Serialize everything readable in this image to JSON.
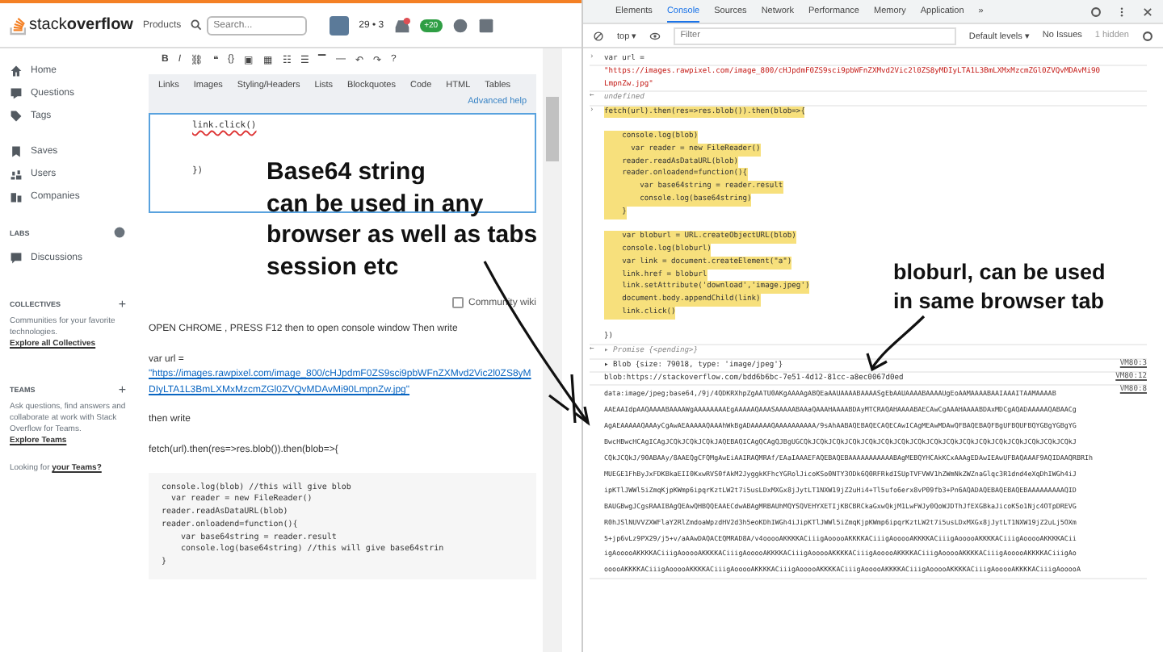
{
  "site": {
    "logo": "stack**overflow**",
    "nav": "Products",
    "search": {
      "placeholder": "Search..."
    },
    "reputation": "29 • 3",
    "achievement": "+20"
  },
  "sidebar": {
    "items": [
      {
        "label": "Home"
      },
      {
        "label": "Questions"
      },
      {
        "label": "Tags"
      }
    ],
    "items2": [
      {
        "label": "Saves"
      },
      {
        "label": "Users"
      },
      {
        "label": "Companies"
      }
    ],
    "labs": {
      "title": "LABS",
      "item": "Discussions"
    },
    "collectives": {
      "title": "COLLECTIVES",
      "add": "+",
      "text": "Communities for your favorite technologies.",
      "link": "Explore all Collectives"
    },
    "teams": {
      "title": "TEAMS",
      "add": "+",
      "text": "Ask questions, find answers and collaborate at work with Stack Overflow for Teams.",
      "link": "Explore Teams"
    },
    "looking": {
      "text": "Looking for",
      "link": "your Teams?"
    }
  },
  "editor": {
    "toolbar": [
      "B",
      "I",
      "⛓",
      "❝",
      "{}",
      "▣",
      "▦",
      "☷",
      "☰",
      "▔",
      "—",
      "↶",
      "↷",
      "?"
    ],
    "help_tabs": [
      "Links",
      "Images",
      "Styling/Headers",
      "Lists",
      "Blockquotes",
      "Code",
      "HTML",
      "Tables"
    ],
    "advanced": "Advanced help",
    "lines": [
      "link.click()",
      "})"
    ],
    "community_wiki": {
      "label": "Community wiki",
      "checked": false
    }
  },
  "answer": {
    "intro": "OPEN CHROME , PRESS F12 then to open console window Then write",
    "var": "var url =",
    "url": "\"https://images.rawpixel.com/image_800/cHJpdmF0ZS9sci9pbWFnZXMvd2Vic2l0ZS8yMDIyLTA1L3BmLXMxMzcmZGl0ZVQvMDAvMi90LmpnZw.jpg\"",
    "then": "then write",
    "fetch": "fetch(url).then(res=>res.blob()).then(blob=>{",
    "code": [
      "console.log(blob) //this will give blob",
      "  var reader = new FileReader()",
      "reader.readAsDataURL(blob)",
      "reader.onloadend=function(){",
      "    var base64string = reader.result",
      "    console.log(base64string) //this will give base64strin",
      "}"
    ]
  },
  "devtools": {
    "tabs": [
      {
        "label": "Elements",
        "selected": false
      },
      {
        "label": "Console",
        "selected": true
      },
      {
        "label": "Sources",
        "selected": false
      },
      {
        "label": "Network",
        "selected": false
      },
      {
        "label": "Performance",
        "selected": false
      },
      {
        "label": "Memory",
        "selected": false
      },
      {
        "label": "Application",
        "selected": false
      }
    ],
    "more": "»",
    "context": "top ▾",
    "filter": {
      "placeholder": "Filter"
    },
    "levels": "Default levels ▾",
    "issues": "No Issues",
    "hidden": "1 hidden",
    "console": [
      {
        "kind": "input",
        "prompt": "›",
        "lines": [
          "var url ="
        ]
      },
      {
        "kind": "string",
        "lines": [
          "\"https://images.rawpixel.com/image_800/cHJpdmF0ZS9sci9pbWFnZXMvd2Vic2l0ZS8yMDIyLTA1L3BmLXMxMzcmZGl0ZVQvMDAvMi90",
          "LmpnZw.jpg\""
        ]
      },
      {
        "kind": "result",
        "prompt": "←",
        "lines": [
          "undefined"
        ]
      },
      {
        "kind": "highlight",
        "prompt": "›",
        "blocks": [
          [
            "fetch(url).then(res=>res.blob()).then(blob=>{"
          ],
          [
            "    console.log(blob)",
            "      var reader = new FileReader()",
            "    reader.readAsDataURL(blob)",
            "    reader.onloadend=function(){",
            "        var base64string = reader.result",
            "        console.log(base64string)",
            "    }"
          ],
          [
            "    var bloburl = URL.createObjectURL(blob)",
            "    console.log(bloburl)",
            "    var link = document.createElement(\"a\")",
            "    link.href = bloburl",
            "    link.setAttribute('download','image.jpeg')",
            "    document.body.appendChild(link)",
            "    link.click()"
          ]
        ],
        "lines": [
          "})"
        ]
      },
      {
        "kind": "result",
        "prompt": "←",
        "lines": [
          "▸ Promise {<pending>}"
        ]
      },
      {
        "kind": "log",
        "lines": [
          "▸ Blob {size: 79018, type: 'image/jpeg'}"
        ],
        "source": "VM80:3"
      },
      {
        "kind": "log",
        "lines": [
          "blob:https://stackoverflow.com/bdd6b6bc-7e51-4d12-81cc-a8ec0067d0ed"
        ],
        "source": "VM80:12"
      },
      {
        "kind": "data",
        "lines": [
          "data:image/jpeg;base64,/9j/4QDKRXhpZgAATU0AKgAAAAgABQEaAAUAAAABAAAASgEbAAUAAAABAAAAUgEoAAMAAAABAAIAAAITAAMAAAAB",
          "AAEAAIdpAAQAAAABAAAAWgAAAAAAAAEgAAAAAQAAASAAAAABAAaQAAAHAAAABDAyMTCRAQAHAAAABAECAwCgAAAHAAAABDAxMDCgAQADAAAAAQABAACg",
          "AgAEAAAAAQAAAyCgAwAEAAAAAQAAAhWkBgADAAAAAQAAAAAAAAAA/9sAhAABAQEBAQECAQECAwICAgMEAwMDAwQFBAQEBAQFBgUFBQUFBQYGBgYGBgYG",
          "BwcHBwcHCAgICAgJCQkJCQkJCQkJAQEBAQICAgQCAgQJBgUGCQkJCQkJCQkJCQkJCQkJCQkJCQkJCQkJCQkJCQkJCQkJCQkJCQkJCQkJCQkJCQkJCQkJ",
          "CQkJCQkJ/90ABAAy/8AAEQgCFQMgAwEiAAIRAQMRAf/EAaIAAAEFAQEBAQEBAAAAAAAAAAABAgMEBQYHCAkKCxAAAgEDAwIEAwUFBAQAAAF9AQIDAAQRBRIh",
          "MUEGE1FhByJxFDKBkaEII0KxwRVS0fAkM2JyggkKFhcYGRolJicoKSo0NTY3ODk6Q0RFRkdISUpTVFVWV1hZWmNkZWZnaGlqc3R1dnd4eXqDhIWGh4iJ",
          "ipKTlJWWl5iZmqKjpKWmp6ipqrKztLW2t7i5usLDxMXGx8jJytLT1NXW19jZ2uHi4+Tl5ufo6erx8vP09fb3+Pn6AQADAQEBAQEBAQEBAAAAAAAAAQID",
          "BAUGBwgJCgsRAAIBAgQEAwQHBQQEAAECdwABAgMRBAUhMQYSQVEHYXETIjKBCBRCkaGxwQkjM1LwFWJy0QoWJDThJfEXGBkaJicoKSo1Njc4OTpDREVG",
          "R0hJSlNUVVZXWFlaY2RlZmdoaWpzdHV2d3h5eoKDhIWGh4iJipKTlJWWl5iZmqKjpKWmp6ipqrKztLW2t7i5usLDxMXGx8jJytLT1NXW19jZ2uLj5OXm",
          "5+jp6vLz9PX29/j5+v/aAAwDAQACEQMRAD8A/v4ooooAKKKKACiiigAooooAKKKKACiiigAooooAKKKKACiiigAooooAKKKKACiiigAooooAKKKKACii",
          "igAooooAKKKKACiiigAooooAKKKKACiiigAooooAKKKKACiiigAooooAKKKKACiiigAooooAKKKKACiiigAooooAKKKKACiiigAooooAKKKKACiiigAo",
          "ooooAKKKKACiiigAooooAKKKKACiiigAooooAKKKKACiiigAooooAKKKKACiiigAooooAKKKKACiiigAooooAKKKKACiiigAooooAKKKKACiiigAooooA"
        ],
        "source": "VM80:8"
      }
    ]
  },
  "annotations": [
    {
      "kind": "left",
      "lines": [
        "Base64 string",
        "can be used in any",
        "browser as well as tabs",
        "session etc"
      ]
    },
    {
      "kind": "right",
      "lines": [
        "bloburl, can be used",
        "in same browser tab"
      ]
    }
  ]
}
